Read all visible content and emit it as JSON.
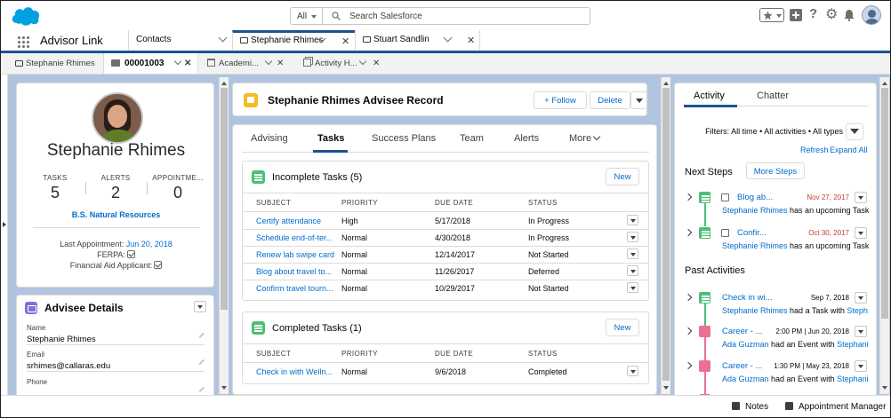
{
  "header": {
    "search_scope": "All",
    "search_placeholder": "Search Salesforce"
  },
  "nav": {
    "app_name": "Advisor Link",
    "tabs": [
      {
        "label": "Contacts"
      },
      {
        "label": "Stephanie Rhimes"
      },
      {
        "label": "Stuart Sandlin"
      }
    ]
  },
  "subtabs": [
    {
      "label": "Stephanie Rhimes"
    },
    {
      "label": "00001003"
    },
    {
      "label": "Academi..."
    },
    {
      "label": "Activity H..."
    }
  ],
  "profile": {
    "name": "Stephanie Rhimes",
    "stats": [
      {
        "label": "TASKS",
        "value": "5"
      },
      {
        "label": "ALERTS",
        "value": "2"
      },
      {
        "label": "APPOINTME...",
        "value": "0"
      }
    ],
    "degree": "B.S. Natural Resources",
    "last_appointment_label": "Last Appointment:",
    "last_appointment_value": "Jun 20, 2018",
    "ferpa_label": "FERPA:",
    "financial_aid_label": "Financial Aid Applicant:"
  },
  "advisee_details": {
    "title": "Advisee Details",
    "fields": [
      {
        "label": "Name",
        "value": "Stephanie Rhimes"
      },
      {
        "label": "Email",
        "value": "srhimes@callaras.edu"
      },
      {
        "label": "Phone",
        "value": ""
      }
    ]
  },
  "record": {
    "title": "Stephanie Rhimes Advisee Record",
    "follow_label": "Follow",
    "delete_label": "Delete",
    "tabs": [
      "Advising",
      "Tasks",
      "Success Plans",
      "Team",
      "Alerts",
      "More"
    ]
  },
  "incomplete_tasks": {
    "title": "Incomplete Tasks (5)",
    "new_label": "New",
    "columns": [
      "SUBJECT",
      "PRIORITY",
      "DUE DATE",
      "STATUS"
    ],
    "rows": [
      {
        "subject": "Certify attendance",
        "priority": "High",
        "due": "5/17/2018",
        "status": "In Progress"
      },
      {
        "subject": "Schedule end-of-ter...",
        "priority": "Normal",
        "due": "4/30/2018",
        "status": "In Progress"
      },
      {
        "subject": "Renew lab swipe card",
        "priority": "Normal",
        "due": "12/14/2017",
        "status": "Not Started"
      },
      {
        "subject": "Blog about travel to...",
        "priority": "Normal",
        "due": "11/26/2017",
        "status": "Deferred"
      },
      {
        "subject": "Confirm travel tourn...",
        "priority": "Normal",
        "due": "10/29/2017",
        "status": "Not Started"
      }
    ]
  },
  "completed_tasks": {
    "title": "Completed Tasks (1)",
    "new_label": "New",
    "columns": [
      "SUBJECT",
      "PRIORITY",
      "DUE DATE",
      "STATUS"
    ],
    "rows": [
      {
        "subject": "Check in with Welln...",
        "priority": "Normal",
        "due": "9/6/2018",
        "status": "Completed"
      }
    ]
  },
  "activity": {
    "tabs": [
      "Activity",
      "Chatter"
    ],
    "filters": "Filters: All time • All activities • All types",
    "refresh": "Refresh",
    "expand_all": "Expand All",
    "next_steps_label": "Next Steps",
    "more_steps_label": "More Steps",
    "past_label": "Past Activities",
    "next_steps": [
      {
        "title": "Blog ab...",
        "date": "Nov 27, 2017",
        "who": "Stephanie Rhimes",
        "desc": " has an upcoming Task"
      },
      {
        "title": "Confir...",
        "date": "Oct 30, 2017",
        "who": "Stephanie Rhimes",
        "desc": " has an upcoming Task"
      }
    ],
    "past": [
      {
        "title": "Check in wi...",
        "date": "Sep 7, 2018",
        "who": "Stephanie Rhimes",
        "desc": " had a Task with ",
        "who2": "Steph..."
      },
      {
        "title": "Career - ...",
        "date": "2:00 PM | Jun 20, 2018",
        "who": "Ada Guzman",
        "desc": " had an Event with ",
        "who2": "Stephani..."
      },
      {
        "title": "Career - ...",
        "date": "1:30 PM | May 23, 2018",
        "who": "Ada Guzman",
        "desc": " had an Event with ",
        "who2": "Stephani..."
      }
    ]
  },
  "footer": {
    "notes": "Notes",
    "appointment_manager": "Appointment Manager"
  },
  "colors": {
    "brand": "#1b5297",
    "link": "#006dcc",
    "task_green": "#4bc076",
    "event_pink": "#eb7092",
    "overdue_red": "#c23934"
  }
}
